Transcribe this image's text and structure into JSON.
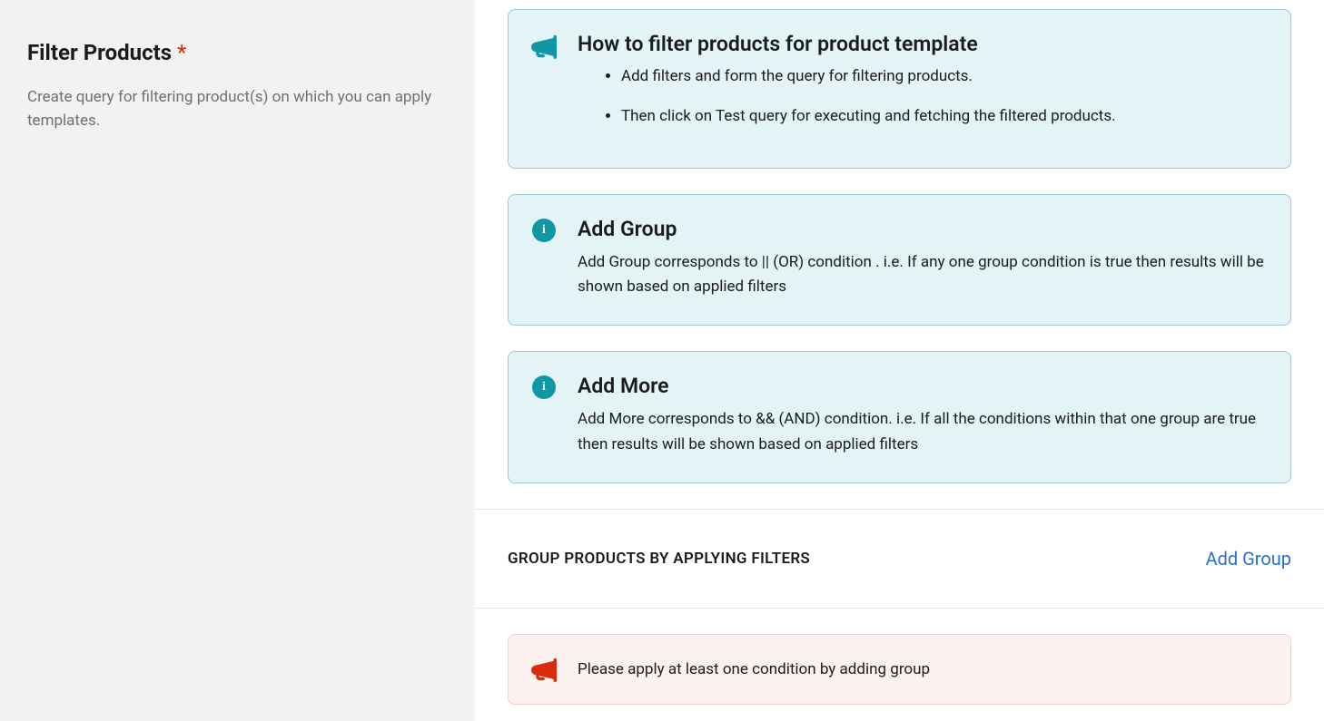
{
  "sidebar": {
    "title": "Filter Products",
    "required_marker": "*",
    "description": "Create query for filtering product(s) on which you can apply templates."
  },
  "cards": {
    "how_to": {
      "title": "How to filter products for product template",
      "items": [
        "Add filters and form the query for filtering products.",
        "Then click on Test query for executing and fetching the filtered products."
      ]
    },
    "add_group": {
      "title": "Add Group",
      "desc": "Add Group corresponds to || (OR) condition . i.e. If any one group condition is true then results will be shown based on applied filters"
    },
    "add_more": {
      "title": "Add More",
      "desc": "Add More corresponds to && (AND) condition. i.e. If all the conditions within that one group are true then results will be shown based on applied filters"
    }
  },
  "section": {
    "heading": "GROUP PRODUCTS BY APPLYING FILTERS",
    "add_group_link": "Add Group"
  },
  "warning": {
    "message": "Please apply at least one condition by adding group"
  }
}
